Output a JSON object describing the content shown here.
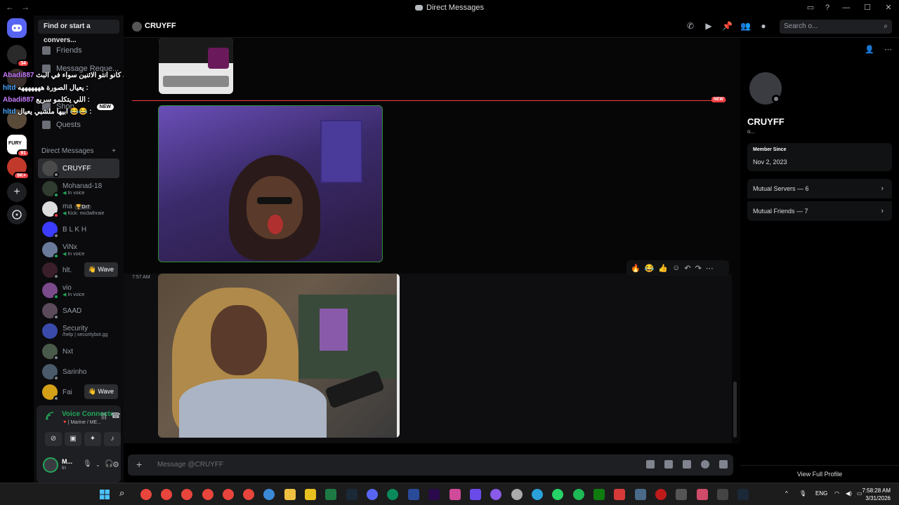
{
  "window": {
    "title": "Direct Messages",
    "back": "←",
    "forward": "→",
    "controls": [
      "▭",
      "?",
      "—",
      "☐",
      "✕"
    ]
  },
  "servers": {
    "badges": [
      "34",
      "91",
      "9K+"
    ],
    "labels": [
      "FURY"
    ]
  },
  "overlay_chat": [
    {
      "user": "Abadi887",
      "text": "اللي كانو انتو الاثنين سواء في البث :"
    },
    {
      "user": "hltd",
      "text": "يعيال الصورة هههههههه :"
    },
    {
      "user": "Abadi887",
      "text": "اللي يتكلمو سريع :"
    },
    {
      "user": "hltd",
      "text": "ابيها ملشبي يعيال 😂😂 :"
    }
  ],
  "sidebar": {
    "search_label": "Find or start a convers...",
    "nav": [
      {
        "label": "Friends"
      },
      {
        "label": "Message Reque..."
      },
      {
        "label": "Shop",
        "badge": "NEW"
      },
      {
        "label": "Quests"
      }
    ],
    "dm_header": "Direct Messages",
    "dm_add": "+",
    "dms": [
      {
        "name": "CRUYFF",
        "sub": "",
        "active": true
      },
      {
        "name": "Mohanad-18",
        "sub": "In voice"
      },
      {
        "name": "ma",
        "tag": "🏆Dr7",
        "sub": "Kick: mo3athraie"
      },
      {
        "name": "B L K H",
        "sub": ""
      },
      {
        "name": "ViNx",
        "sub": "In voice"
      },
      {
        "name": "hlt.",
        "sub": "",
        "wave": "👋 Wave"
      },
      {
        "name": "vio",
        "sub": "In voice"
      },
      {
        "name": "SAAD",
        "sub": ""
      },
      {
        "name": "Security",
        "sub": "/help | securitybot.gg"
      },
      {
        "name": "Nxt",
        "sub": ""
      },
      {
        "name": "Sarinho",
        "sub": ""
      },
      {
        "name": "Fai",
        "sub": "",
        "wave": "👋 Wave"
      }
    ],
    "voice": {
      "title": "Voice Connecte",
      "sub": "🔻| Marine / ME...",
      "user_name": "M...",
      "user_status": "In"
    }
  },
  "chat": {
    "title": "CRUYFF",
    "search_placeholder": "Search o...",
    "new_label": "NEW",
    "timestamp": "7:57 AM",
    "reactions": [
      "🔥",
      "😂",
      "👍"
    ],
    "composer_placeholder": "Message @CRUYFF",
    "composer_plus": "+"
  },
  "profile": {
    "name": "CRUYFF",
    "tag": "o...",
    "member_since_label": "Member Since",
    "member_since": "Nov 2, 2023",
    "mutual_servers": "Mutual Servers — 6",
    "mutual_friends": "Mutual Friends — 7",
    "view_full": "View Full Profile"
  },
  "taskbar": {
    "lang": "ENG",
    "time": "7:58:28 AM",
    "date": "3/31/2026",
    "chevron": "^"
  },
  "colors": {
    "accent": "#5865f2",
    "danger": "#f23f43",
    "online": "#23a55a"
  }
}
